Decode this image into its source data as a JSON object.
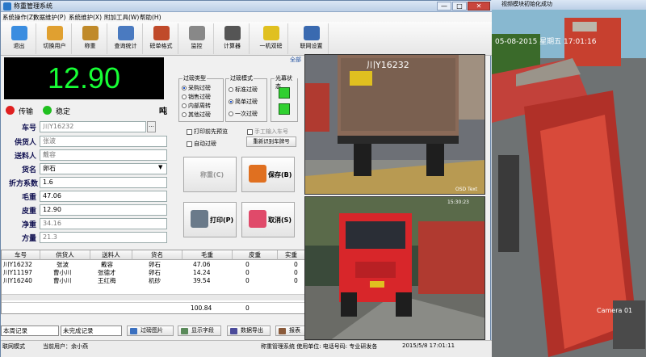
{
  "main_window": {
    "title": "称重管理系统",
    "controls": {
      "min": "—",
      "max": "□",
      "close": "✕"
    }
  },
  "menu": [
    "系统操作(Z)",
    "数据维护(P)",
    "系统维护(X)",
    "附加工具(W)",
    "帮助(H)"
  ],
  "toolbar": [
    {
      "label": "退出",
      "icon": "exit-icon",
      "color": "#3a8de0"
    },
    {
      "label": "切换用户",
      "icon": "users-icon",
      "color": "#e0a030"
    },
    {
      "label": "称重",
      "icon": "scale-icon",
      "color": "#c08a2a"
    },
    {
      "label": "查询统计",
      "icon": "chart-icon",
      "color": "#4a7ac0"
    },
    {
      "label": "磅单格式",
      "icon": "tools-icon",
      "color": "#c04a2a"
    },
    {
      "label": "监控",
      "icon": "camera-icon",
      "color": "#888888"
    },
    {
      "label": "计算器",
      "icon": "calculator-icon",
      "color": "#555555"
    },
    {
      "label": "一机双磅",
      "icon": "truck-icon",
      "color": "#e0c020"
    },
    {
      "label": "联网设置",
      "icon": "network-icon",
      "color": "#3a6ab0"
    }
  ],
  "full_screen": "全部",
  "weight": {
    "value": "12.90",
    "unit": "吨"
  },
  "indicators": {
    "transmit": "传输",
    "stable": "稳定",
    "transmit_color": "#e02020",
    "stable_color": "#20c020"
  },
  "form": [
    {
      "label": "车号",
      "value": "川Y16232",
      "active": false
    },
    {
      "label": "供货人",
      "value": "张波",
      "active": false
    },
    {
      "label": "送料人",
      "value": "戴容",
      "active": false
    },
    {
      "label": "货名",
      "value": "卵石",
      "active": true
    },
    {
      "label": "折方系数",
      "value": "1.6",
      "active": true
    },
    {
      "label": "毛重",
      "value": "47.06",
      "active": true
    },
    {
      "label": "皮重",
      "value": "12.90",
      "active": true
    },
    {
      "label": "净重",
      "value": "34.16",
      "active": false
    },
    {
      "label": "方量",
      "value": "21.3",
      "active": false
    }
  ],
  "weigh_type": {
    "title": "过磅类型",
    "options": [
      "采购过磅",
      "销售过磅",
      "内部周转",
      "其他过磅"
    ],
    "selected": 0
  },
  "weigh_mode": {
    "title": "过磅模式",
    "options": [
      "标准过磅",
      "简单过磅",
      "一次过磅"
    ],
    "selected": 1
  },
  "light_status": {
    "title": "光幕状态",
    "color": "#30d030"
  },
  "checks": {
    "print_preview": "打印前先预览",
    "manual_plate": "手工输入车号",
    "auto_weigh": "自动过磅",
    "reidentify": "重新识别车牌号"
  },
  "buttons": {
    "weigh": "称重(C)",
    "save": "保存(B)",
    "print": "打印(P)",
    "cancel": "取消(S)"
  },
  "table": {
    "headers": [
      "车号",
      "供货人",
      "送料人",
      "货名",
      "毛重",
      "皮重",
      "实重"
    ],
    "rows": [
      [
        "川Y16232",
        "张波",
        "戴容",
        "卵石",
        "47.06",
        "0",
        "0"
      ],
      [
        "川Y11197",
        "曹小川",
        "张德才",
        "卵石",
        "14.24",
        "0",
        "0"
      ],
      [
        "川Y16240",
        "曹小川",
        "王红梅",
        "机砂",
        "39.54",
        "0",
        "0"
      ]
    ],
    "total": "100.84",
    "total_zero": "0"
  },
  "bottom": {
    "period": "本周记录",
    "filter": "未完成记录",
    "photos": "过磅图片",
    "show_fields": "显示字段",
    "export": "数据导出",
    "report": "报表"
  },
  "status": {
    "mode": "联网模式",
    "user": "当前用户：余小燕",
    "system": "称重管理系统  使用单位: 电话号码:  专业研发各",
    "datetime": "2015/5/8  17:01:11"
  },
  "cameras": {
    "cam1_plate": "川Y16232",
    "cam1_caption": "OSD Text",
    "cam2_time": "15:30:23",
    "video_title": "视频模块初始化成功",
    "video_date": "05-08-2015  星期五  17:01:16",
    "video_caption": "Camera 01"
  }
}
